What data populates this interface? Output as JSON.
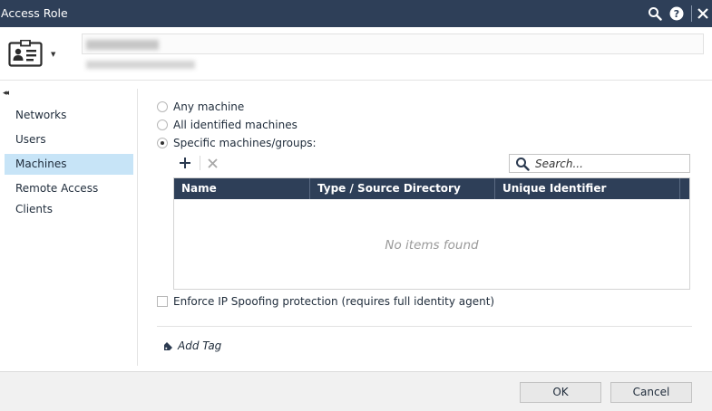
{
  "window": {
    "title": "Access Role"
  },
  "header": {
    "name_placeholder": "",
    "comment_placeholder": ""
  },
  "sidebar": {
    "items": [
      {
        "label": "Networks"
      },
      {
        "label": "Users"
      },
      {
        "label": "Machines",
        "active": true
      },
      {
        "label": "Remote Access Clients"
      }
    ]
  },
  "machines": {
    "options": [
      {
        "label": "Any machine",
        "selected": false
      },
      {
        "label": "All identified machines",
        "selected": false
      },
      {
        "label": "Specific machines/groups:",
        "selected": true
      }
    ],
    "search_placeholder": "Search...",
    "table": {
      "columns": [
        "Name",
        "Type / Source Directory",
        "Unique Identifier"
      ],
      "rows": [],
      "empty_text": "No items found"
    },
    "enforce_ip_spoofing": {
      "label": "Enforce IP Spoofing protection (requires full identity agent)",
      "checked": false
    },
    "add_tag_label": "Add Tag"
  },
  "footer": {
    "ok_label": "OK",
    "cancel_label": "Cancel"
  },
  "colors": {
    "titlebar": "#2e3f58",
    "table_header": "#2e3f58",
    "nav_active": "#c7e4f7"
  }
}
